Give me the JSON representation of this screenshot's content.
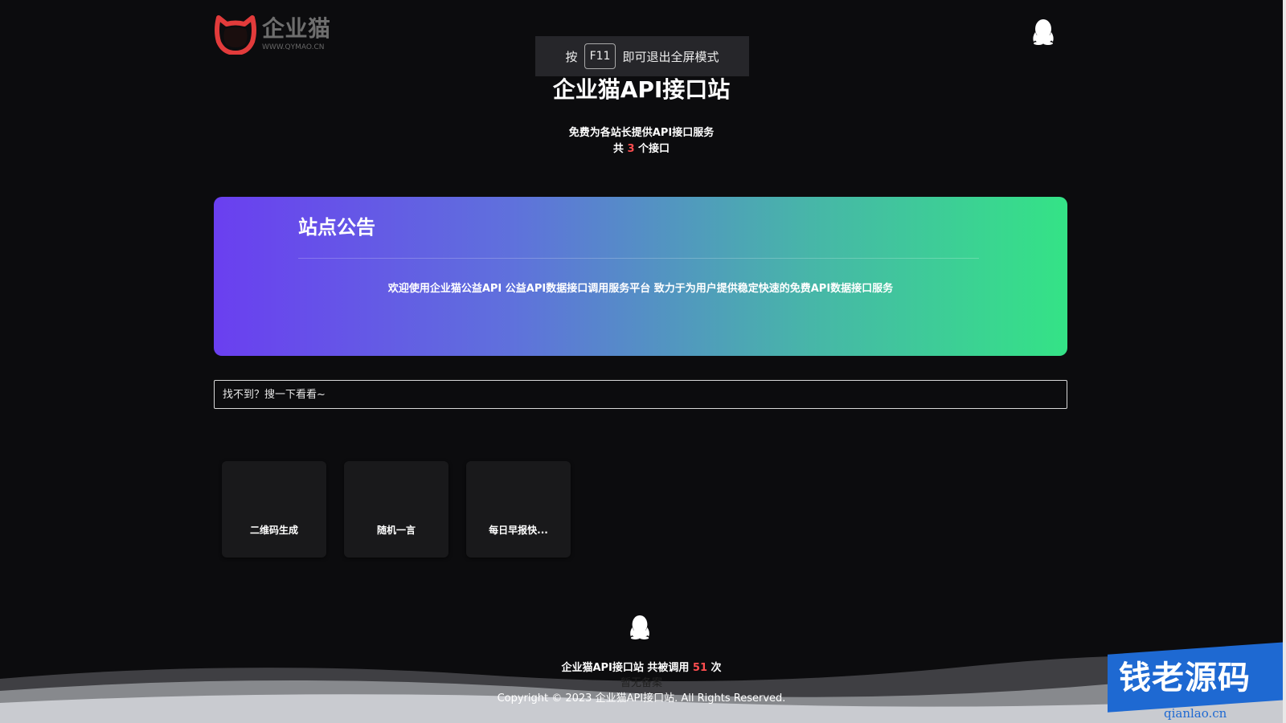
{
  "logo": {
    "name": "企业猫",
    "url_text": "WWW.QYMAO.CN"
  },
  "fullscreen_toast": {
    "prefix": "按",
    "key": "F11",
    "suffix": "即可退出全屏模式"
  },
  "header": {
    "title": "企业猫API接口站",
    "subtitle": "免费为各站长提供API接口服务",
    "count_prefix": "共",
    "count": "3",
    "count_suffix": "个接口"
  },
  "notice": {
    "title": "站点公告",
    "text": "欢迎使用企业猫公益API 公益API数据接口调用服务平台 致力于为用户提供稳定快速的免费API数据接口服务"
  },
  "search": {
    "placeholder": "找不到？搜一下看看~"
  },
  "apis": [
    {
      "label": "二维码生成"
    },
    {
      "label": "随机一言"
    },
    {
      "label": "每日早报快..."
    }
  ],
  "footer": {
    "stats_prefix": "企业猫API接口站 共被调用",
    "calls": "51",
    "stats_suffix": "次",
    "beian": "暂无备案",
    "copyright": "Copyright © 2023 企业猫API接口站. All Rights Reserved."
  },
  "watermark": {
    "text": "钱老源码",
    "url": "qianlao.cn"
  },
  "colors": {
    "background": "#0c0c0e",
    "accent_red": "#ff4d4f",
    "gradient_start": "#6a3ff0",
    "gradient_end": "#34e386",
    "watermark_blue": "#1e69d2"
  },
  "icons": {
    "logo": "cat-head-logo-icon",
    "qq": "qq-penguin-icon"
  }
}
